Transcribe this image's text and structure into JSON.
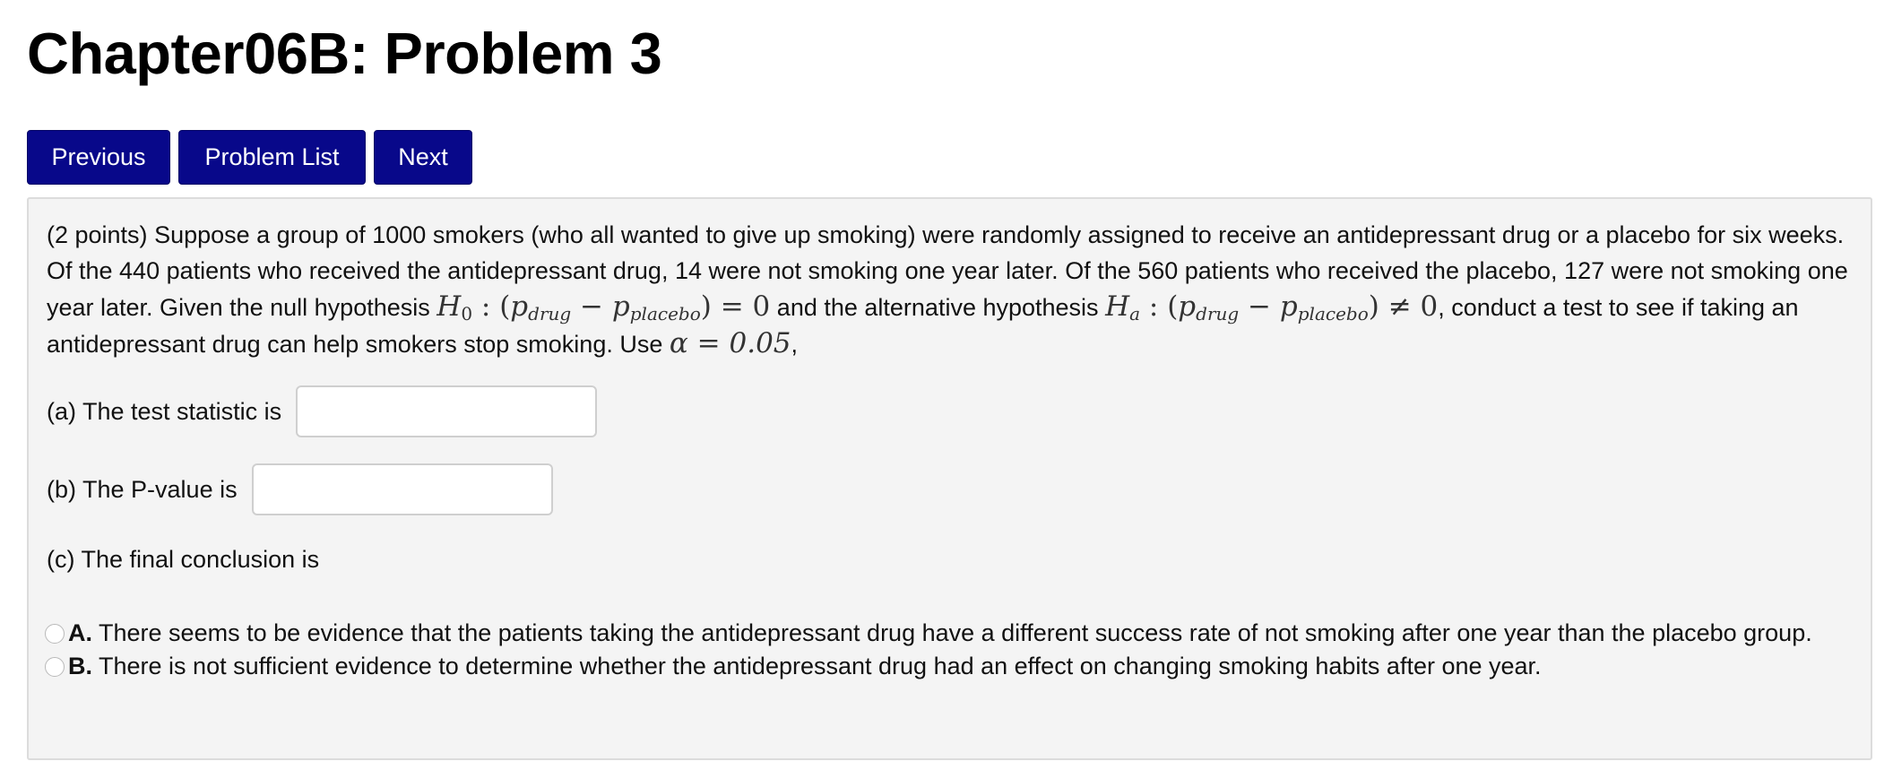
{
  "page": {
    "title": "Chapter06B: Problem 3"
  },
  "nav": {
    "previous_label": "Previous",
    "problem_list_label": "Problem List",
    "next_label": "Next"
  },
  "problem": {
    "points": "(2 points)",
    "text_1": "Suppose a group of 1000 smokers (who all wanted to give up smoking) were randomly assigned to receive an antidepressant drug or a placebo for six weeks. Of the 440 patients who received the antidepressant drug, 14 were not smoking one year later. Of the 560 patients who received the placebo, 127 were not smoking one year later. Given the null hypothesis",
    "text_2": "and the alternative hypothesis",
    "text_3": ", conduct a test to see if taking an antidepressant drug can help smokers stop smoking. Use",
    "null_hypothesis": {
      "symbol": "H",
      "subscript": "0",
      "relation": "= 0"
    },
    "alt_hypothesis": {
      "symbol": "H",
      "subscript": "a",
      "relation": "≠ 0"
    },
    "p_symbol": "p",
    "drug_subscript": "drug",
    "placebo_subscript": "placebo",
    "alpha_text": "α = 0.05",
    "end_punct": ","
  },
  "questions": {
    "a_label": "(a) The test statistic is",
    "a_value": "",
    "b_label": "(b) The P-value is",
    "b_value": "",
    "c_label": "(c) The final conclusion is"
  },
  "options": [
    {
      "letter": "A.",
      "text": "There seems to be evidence that the patients taking the antidepressant drug have a different success rate of not smoking after one year than the placebo group."
    },
    {
      "letter": "B.",
      "text": "There is not sufficient evidence to determine whether the antidepressant drug had an effect on changing smoking habits after one year."
    }
  ],
  "colors": {
    "nav_button_bg": "#08088a",
    "panel_bg": "#f4f4f4"
  }
}
